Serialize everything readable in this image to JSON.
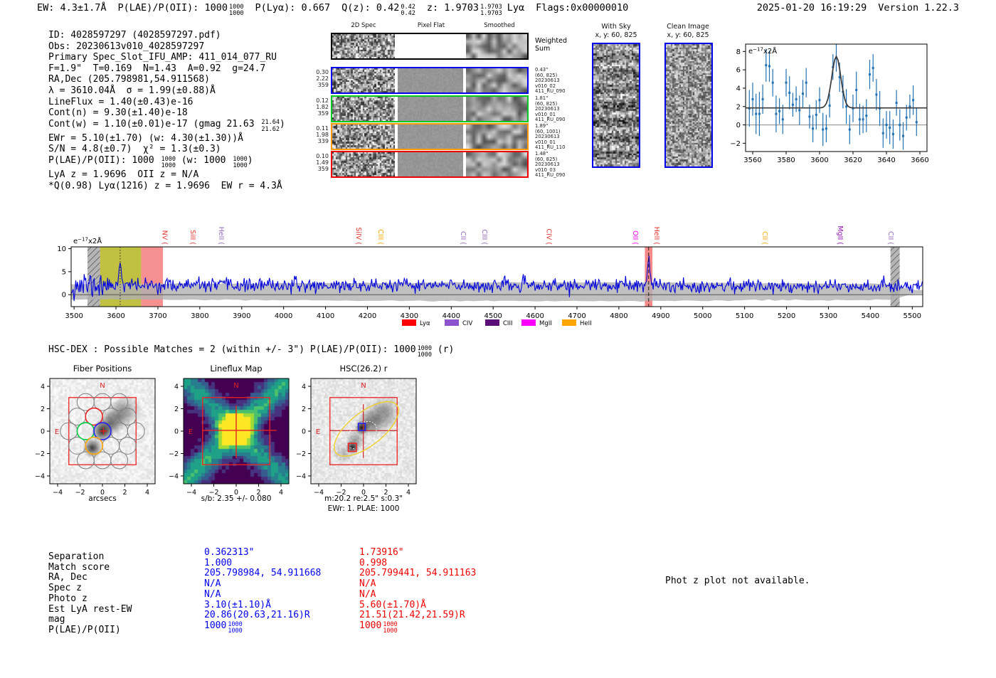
{
  "header": {
    "ew": "EW: 4.3±1.7Å",
    "plae": "P(LAE)/P(OII): 1000",
    "plae_sup": "1000",
    "plae_sub": "1000",
    "plya": "P(Lyα): 0.667",
    "qz": "Q(z): 0.42",
    "qz_sup": "0.42",
    "qz_sub": "0.42",
    "z": "z: 1.9703",
    "z_sup": "1.9703",
    "z_sub": "1.9703",
    "line_id": "Lyα",
    "flags": "Flags:0x00000010",
    "datetime": "2025-01-20 16:19:29",
    "version": "Version 1.22.3"
  },
  "info_lines": [
    {
      "segs": [
        {
          "t": "ID: 4028597297 (4028597297.pdf)"
        }
      ]
    },
    {
      "segs": [
        {
          "t": "Obs: 20230613v010_4028597297"
        }
      ]
    },
    {
      "segs": [
        {
          "t": "Primary Spec_Slot_IFU_AMP: 411_014_077_RU"
        }
      ]
    },
    {
      "segs": [
        {
          "t": "F=1.9\"  T=0.169  N=1.43  A=0.92  g=24.7"
        }
      ]
    },
    {
      "segs": [
        {
          "t": "RA,Dec (205.798981,54.911568)"
        }
      ]
    },
    {
      "segs": [
        {
          "t": "λ = 3610.04Å  σ = 1.99(±0.88)Å"
        }
      ]
    },
    {
      "segs": [
        {
          "t": "LineFlux = 1.40(±0.43)e-16"
        }
      ]
    },
    {
      "segs": [
        {
          "t": "Cont(n) = 9.30(±1.40)e-18"
        }
      ]
    },
    {
      "segs": [
        {
          "t": "Cont(w) = 1.10(±0.01)e-17 (gmag 21.63 "
        },
        {
          "sup": "21.64",
          "sub": "21.62"
        },
        {
          "t": ")"
        }
      ]
    },
    {
      "segs": [
        {
          "t": "EWr = 5.10(±1.70) (w: 4.30(±1.30))Å"
        }
      ]
    },
    {
      "segs": [
        {
          "t": "S/N = 4.8(±0.7)  χ² = 1.3(±0.3)"
        }
      ]
    },
    {
      "segs": [
        {
          "t": "P(LAE)/P(OII): 1000 "
        },
        {
          "sup": "1000",
          "sub": "1000"
        },
        {
          "t": " (w: 1000 "
        },
        {
          "sup": "1000",
          "sub": "1000"
        },
        {
          "t": ")"
        }
      ]
    },
    {
      "segs": [
        {
          "t": "LyA z = 1.9696  OII z = N/A"
        }
      ]
    },
    {
      "segs": [
        {
          "t": "*Q(0.98) Lyα(1216) z = 1.9696  EW r = 4.3Å"
        }
      ]
    }
  ],
  "twod": {
    "col_headers": [
      "2D Spec",
      "Pixel Flat",
      "Smoothed"
    ],
    "rows": [
      {
        "border": "#000000",
        "left": [],
        "right": [
          "Weighted",
          "Sum"
        ],
        "big_right": true,
        "flat": "white"
      },
      {
        "border": "#0000ee",
        "left": [
          "0.30",
          "2.22",
          "359"
        ],
        "right": [
          "0.43\"",
          "(60, 825)",
          "20230613",
          "v010_02",
          "411_RU_090"
        ]
      },
      {
        "border": "#00cc22",
        "left": [
          "0.12",
          "1.82",
          "359"
        ],
        "right": [
          "1.81\"",
          "(60, 825)",
          "20230613",
          "v010_01",
          "411_RU_090"
        ]
      },
      {
        "border": "#ff9900",
        "left": [
          "0.11",
          "1.98",
          "339"
        ],
        "right": [
          "1.89\"",
          "(60, 1001)",
          "20230613",
          "v010_01",
          "411_RU_110"
        ]
      },
      {
        "border": "#ee0000",
        "left": [
          "0.10",
          "1.49",
          "359"
        ],
        "right": [
          "1.48\"",
          "(60, 825)",
          "20230613",
          "v010_03",
          "411_RU_090"
        ]
      }
    ]
  },
  "cutouts": {
    "with_sky": {
      "title": "With Sky",
      "subtitle": "x, y: 60, 825"
    },
    "clean": {
      "title": "Clean Image",
      "subtitle": "x, y: 60, 825"
    }
  },
  "hscdex": {
    "pre": "HSC-DEX : Possible Matches = 2 (within +/- 3\")  P(LAE)/P(OII): 1000",
    "sup": "1000",
    "sub": "1000",
    "post": " (r)"
  },
  "photz_note": "Phot z plot not available.",
  "match_table": {
    "rows": [
      {
        "label": "Separation",
        "blue": "0.362313\"",
        "red": "1.73916\""
      },
      {
        "label": "Match score",
        "blue": "1.000",
        "red": "0.998"
      },
      {
        "label": "RA, Dec",
        "blue": "205.798984, 54.911668",
        "red": "205.799441, 54.911163"
      },
      {
        "label": "Spec z",
        "blue": "N/A",
        "red": "N/A"
      },
      {
        "label": "Photo z",
        "blue": "N/A",
        "red": "N/A"
      },
      {
        "label": "Est LyA rest-EW",
        "blue": "3.10(±1.10)Å",
        "red": "5.60(±1.70)Å"
      },
      {
        "label": "mag",
        "blue": "20.86(20.63,21.16)R",
        "red": "21.51(21.42,21.59)R"
      },
      {
        "label": "P(LAE)/P(OII)",
        "blue": "1000",
        "blue_sup": "1000",
        "blue_sub": "1000",
        "red": "1000",
        "red_sup": "1000",
        "red_sub": "1000"
      }
    ]
  },
  "chart_data": [
    {
      "id": "line_fit_zoom",
      "type": "scatter",
      "unit_label": {
        "base": "e",
        "exp": "−17",
        "suffix": "x2Å"
      },
      "xlim": [
        3556,
        3664
      ],
      "ylim": [
        -2.9,
        8.8
      ],
      "xticks": [
        3560,
        3580,
        3600,
        3620,
        3640,
        3660
      ],
      "yticks": [
        -2,
        0,
        2,
        4,
        6,
        8
      ],
      "x_start": 3558,
      "x_step": 2,
      "values": [
        1.8,
        2.8,
        1.2,
        1.2,
        2.8,
        6.5,
        6.4,
        4.6,
        1.2,
        1.5,
        0.6,
        4.6,
        3.5,
        2.2,
        2.8,
        1.6,
        3.4,
        4.6,
        0.9,
        -0.4,
        1.1,
        2.7,
        -0.5,
        -0.4,
        2.1,
        6.3,
        7.3,
        5.2,
        3.6,
        2.0,
        -0.5,
        1.8,
        3.8,
        0.6,
        0.6,
        1.0,
        5.5,
        6.2,
        3.3,
        1.8,
        -0.9,
        0.0,
        -0.3,
        -1.0,
        2.4,
        0.0,
        -1.2,
        0.8,
        2.0,
        2.7,
        0.3
      ],
      "errors": [
        2.0,
        1.8,
        2.2,
        2.4,
        1.6,
        1.8,
        1.7,
        1.5,
        2.0,
        1.4,
        1.6,
        1.5,
        1.8,
        1.3,
        1.4,
        1.6,
        1.5,
        1.6,
        1.3,
        1.5,
        1.6,
        1.4,
        1.8,
        1.5,
        1.3,
        1.4,
        1.5,
        1.6,
        1.8,
        1.9,
        1.6,
        1.5,
        2.0,
        1.7,
        1.5,
        1.8,
        1.6,
        1.5,
        1.7,
        1.9,
        1.6,
        1.5,
        1.8,
        1.6,
        1.4,
        1.7,
        1.5,
        1.4,
        1.3,
        1.6,
        1.5
      ],
      "fit": {
        "continuum": 1.85,
        "center": 3610,
        "sigma": 2.7,
        "amplitude": 5.6
      },
      "marker_color": "#2272b4",
      "fit_color": "#3a3a3a"
    },
    {
      "id": "full_spectrum",
      "type": "line",
      "unit_label": {
        "base": "e",
        "exp": "−17",
        "suffix": "x2Å"
      },
      "xlim": [
        3493,
        5525
      ],
      "ylim": [
        -2.6,
        10.4
      ],
      "xticks": [
        3500,
        3600,
        3700,
        3800,
        3900,
        4000,
        4100,
        4200,
        4300,
        4400,
        4500,
        4600,
        4700,
        4800,
        4900,
        5000,
        5100,
        5200,
        5300,
        5400,
        5500
      ],
      "yticks": [
        0,
        5,
        10
      ],
      "line_color": "#0000dd",
      "continuum": 2.05,
      "noise_sigma": 0.72,
      "blue_noise_sigma": 1.55,
      "seed": 11,
      "peaks": [
        {
          "center": 3610,
          "amplitude": 5.2,
          "sigma": 3.0
        },
        {
          "center": 4871,
          "amplitude": 6.0,
          "sigma": 2.6
        }
      ],
      "bands": [
        {
          "x1": 3532,
          "x2": 3562,
          "style": "hatch"
        },
        {
          "x1": 3562,
          "x2": 3660,
          "style": "solid",
          "color": "#b9b92e",
          "opacity": 0.9
        },
        {
          "x1": 3660,
          "x2": 3712,
          "style": "solid",
          "color": "#f47c7c",
          "opacity": 0.85
        },
        {
          "x1": 4862,
          "x2": 4880,
          "style": "solid",
          "color": "#f47c7c",
          "opacity": 0.9
        },
        {
          "x1": 5448,
          "x2": 5470,
          "style": "hatch"
        }
      ],
      "marker_lines": [
        {
          "x": 3610,
          "dash": "dotted"
        },
        {
          "x": 4871,
          "dash": "dashed"
        }
      ],
      "emission_labels": [
        {
          "label": "NV",
          "wave": 3706,
          "color": "#e6352f"
        },
        {
          "label": "SiII",
          "wave": 3773,
          "color": "#e6352f"
        },
        {
          "label": "HeII",
          "wave": 3841,
          "color": "#9467bd"
        },
        {
          "label": "SiIV",
          "wave": 4169,
          "color": "#e6352f"
        },
        {
          "label": "CIII",
          "wave": 4221,
          "color": "#ffa500"
        },
        {
          "label": "CII",
          "wave": 4418,
          "color": "#9467bd"
        },
        {
          "label": "CIII",
          "wave": 4469,
          "color": "#9467bd"
        },
        {
          "label": "CIV",
          "wave": 4623,
          "color": "#e6352f"
        },
        {
          "label": "OII",
          "wave": 4829,
          "color": "#ff00ff"
        },
        {
          "label": "HeII",
          "wave": 4880,
          "color": "#e6352f"
        },
        {
          "label": "CII",
          "wave": 5138,
          "color": "#ffa500"
        },
        {
          "label": "MgII",
          "wave": 5318,
          "color": "#8f0fb4"
        },
        {
          "label": "CII",
          "wave": 5438,
          "color": "#9467bd"
        }
      ],
      "legend": [
        {
          "label": "Lyα",
          "color": "#ff0000"
        },
        {
          "label": "CIV",
          "color": "#8c51cc"
        },
        {
          "label": "CIII",
          "color": "#5c0e78"
        },
        {
          "label": "MgII",
          "color": "#ff00ff"
        },
        {
          "label": "HeII",
          "color": "#ffa500"
        }
      ]
    },
    {
      "id": "fiber_positions",
      "type": "image-overlay",
      "title": "Fiber Positions",
      "xlabel": "arcsecs",
      "ticks": [
        -4,
        -2,
        0,
        2,
        4
      ],
      "compass": {
        "n": "N",
        "e": "E"
      },
      "fiber_radius": 0.76,
      "fibers": [
        [
          -1.5,
          2.6
        ],
        [
          0,
          2.6
        ],
        [
          1.5,
          2.6
        ],
        [
          -2.25,
          1.3
        ],
        [
          0.75,
          1.3
        ],
        [
          2.25,
          1.3
        ],
        [
          -3,
          0
        ],
        [
          1.5,
          0
        ],
        [
          3,
          0
        ],
        [
          -2.25,
          -1.3
        ],
        [
          0.75,
          -1.3
        ],
        [
          2.25,
          -1.3
        ],
        [
          -1.5,
          -2.6
        ],
        [
          0,
          -2.6
        ],
        [
          1.5,
          -2.6
        ]
      ],
      "highlight_fibers": [
        {
          "x": -0.75,
          "y": 1.3,
          "color": "#ee2222"
        },
        {
          "x": -1.5,
          "y": 0,
          "color": "#00cc44"
        },
        {
          "x": 0,
          "y": 0,
          "color": "#2222ee"
        },
        {
          "x": -0.75,
          "y": -1.3,
          "color": "#ffa500"
        }
      ],
      "box": {
        "half": 3,
        "color": "#ee2222"
      }
    },
    {
      "id": "lineflux_map",
      "type": "heatmap",
      "title": "Lineflux Map",
      "xlabel": "s/b: 2.35 +/- 0.080",
      "ticks": [
        -4,
        -2,
        0,
        2,
        4
      ],
      "compass": {
        "n": "N",
        "e": "E"
      },
      "box": {
        "half": 3,
        "color": "#ee2222"
      },
      "colormap": "viridis"
    },
    {
      "id": "hsc_r",
      "type": "image-overlay",
      "title": "HSC(26.2) r",
      "xlabel": "m:20.2  re:2.5\"  s:0.3\"",
      "xlabel2": "EWr: 1. PLAE: 1000",
      "ticks": [
        -4,
        -2,
        0,
        2,
        4
      ],
      "compass": {
        "n": "N",
        "e": "E"
      },
      "box": {
        "half": 3,
        "color": "#ee2222"
      },
      "ellipse": {
        "cx": 0.25,
        "cy": 0.2,
        "rx": 3.45,
        "ry": 1.5,
        "angle": -38,
        "color": "#f2cf2a"
      },
      "blue_box": {
        "x": -0.15,
        "y": 0.38,
        "size": 0.62,
        "color": "#2222ee"
      },
      "red_box": {
        "x": -1.0,
        "y": -1.45,
        "size": 0.72,
        "color": "#ee2222"
      }
    }
  ]
}
